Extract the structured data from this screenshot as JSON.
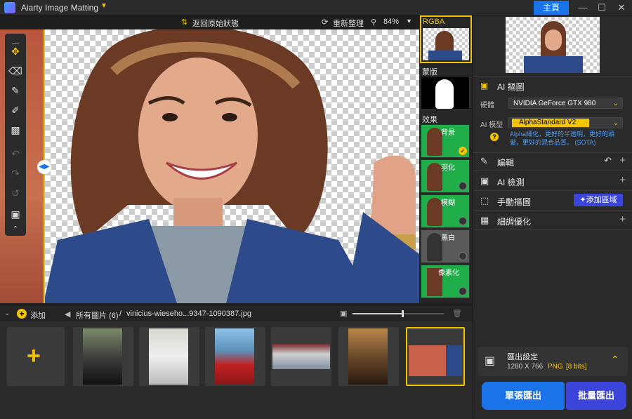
{
  "app": {
    "title": "Aiarty Image Matting",
    "home_label": "主頁"
  },
  "toolbar": {
    "back_label": "返回原始狀態",
    "reset_label": "重新整理",
    "zoom": "84%"
  },
  "effects": {
    "rgba_label": "RGBA",
    "mask_label": "蒙版",
    "effect_label": "效果",
    "items": [
      {
        "label": "背景"
      },
      {
        "label": "羽化"
      },
      {
        "label": "模糊"
      },
      {
        "label": "黑白"
      },
      {
        "label": "像素化"
      }
    ]
  },
  "panel": {
    "ai_matting": "AI 摳圖",
    "hardware_label": "硬體",
    "hardware_value": "NVIDIA GeForce GTX 980",
    "model_label": "AI 模型",
    "model_value": "AlphaStandard  V2",
    "model_desc": "Alpha細化，更好的半透明，更好的頭髮，更好的混合品質。 (SOTA)",
    "edit": "編輯",
    "ai_detect": "AI 檢測",
    "manual": "手動摳圖",
    "add_region": "添加區域",
    "refine": "細調優化",
    "export_title": "匯出設定",
    "export_size": "1280 X 766",
    "export_format": "PNG",
    "export_bits": "[8 bits]",
    "single_export": "單張匯出",
    "batch_export": "批量匯出"
  },
  "filebar": {
    "add_label": "添加",
    "all_images": "所有圖片 (6)",
    "separator": "/",
    "filename": "vinicius-wieseho...9347-1090387.jpg"
  },
  "colors": {
    "accent": "#1a73e8",
    "highlight": "#f5c400",
    "green": "#1fae49"
  }
}
